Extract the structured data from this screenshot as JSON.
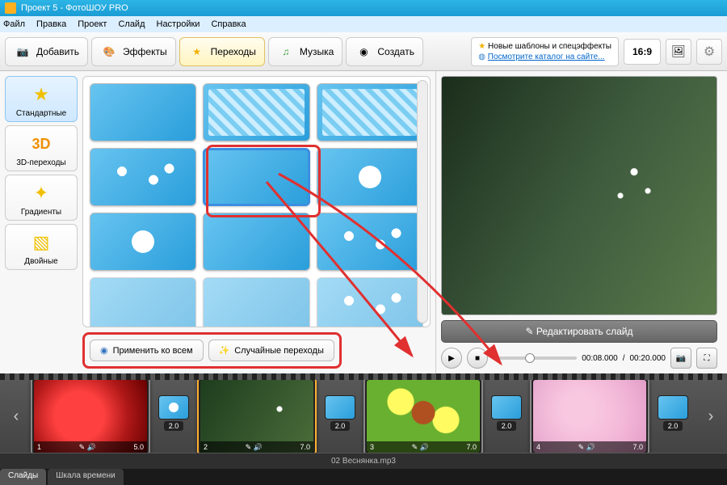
{
  "title": "Проект 5 - ФотоШОУ PRO",
  "menu": {
    "file": "Файл",
    "edit": "Правка",
    "project": "Проект",
    "slide": "Слайд",
    "settings": "Настройки",
    "help": "Справка"
  },
  "tabs": {
    "add": "Добавить",
    "effects": "Эффекты",
    "transitions": "Переходы",
    "music": "Музыка",
    "create": "Создать"
  },
  "news": {
    "line1": "Новые шаблоны и спецэффекты",
    "line2": "Посмотрите каталог на сайте..."
  },
  "aspect": "16:9",
  "categories": {
    "standard": "Стандартные",
    "three_d": "3D-переходы",
    "gradients": "Градиенты",
    "double": "Двойные"
  },
  "actions": {
    "apply_all": "Применить ко всем",
    "random": "Случайные переходы"
  },
  "preview": {
    "edit_slide": "Редактировать слайд",
    "time_cur": "00:08.000",
    "time_total": "00:20.000"
  },
  "timeline": {
    "slides": [
      {
        "num": "1",
        "dur": "5.0",
        "trans_dur": "2.0"
      },
      {
        "num": "2",
        "dur": "7.0",
        "trans_dur": "2.0"
      },
      {
        "num": "3",
        "dur": "7.0",
        "trans_dur": "2.0"
      },
      {
        "num": "4",
        "dur": "7.0",
        "trans_dur": "2.0"
      }
    ],
    "audio": "02 Веснянка.mp3"
  },
  "bottom_tabs": {
    "slides": "Слайды",
    "timescale": "Шкала времени"
  }
}
